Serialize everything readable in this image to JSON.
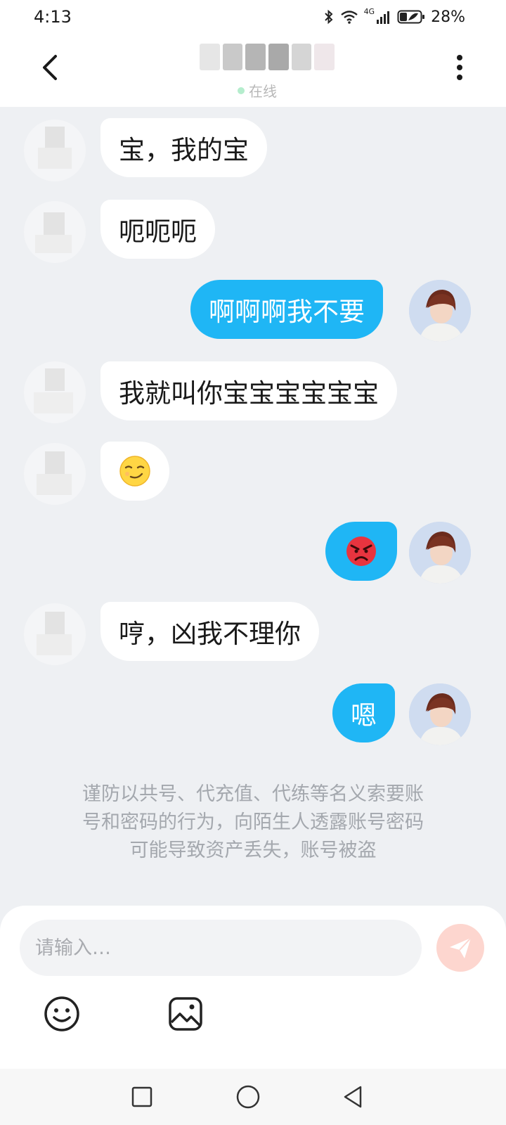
{
  "status_bar": {
    "time": "4:13",
    "network": "4G",
    "battery": "28%"
  },
  "header": {
    "status": "在线",
    "name_redacted": true
  },
  "messages": [
    {
      "side": "in",
      "text": "宝，我的宝"
    },
    {
      "side": "in",
      "text": "呃呃呃"
    },
    {
      "side": "out",
      "text": "啊啊啊我不要"
    },
    {
      "side": "in",
      "text": "我就叫你宝宝宝宝宝宝"
    },
    {
      "side": "in",
      "emoji": "smirk-face"
    },
    {
      "side": "out",
      "emoji": "angry-face"
    },
    {
      "side": "in",
      "text": "哼，凶我不理你"
    },
    {
      "side": "out",
      "text": "嗯"
    }
  ],
  "notice": {
    "line1": "谨防以共号、代充值、代练等名义索要账",
    "line2": "号和密码的行为，向陌生人透露账号密码",
    "line3": "可能导致资产丢失，账号被盗"
  },
  "composer": {
    "placeholder": "请输入…"
  },
  "icons": {
    "back": "chevron-left-icon",
    "more": "more-vertical-icon",
    "send": "paper-plane-icon",
    "emoji": "smile-icon",
    "image": "image-icon"
  },
  "colors": {
    "accent": "#1fb6f5",
    "send_disabled": "#fdd6cf",
    "chat_bg": "#eef0f3"
  }
}
